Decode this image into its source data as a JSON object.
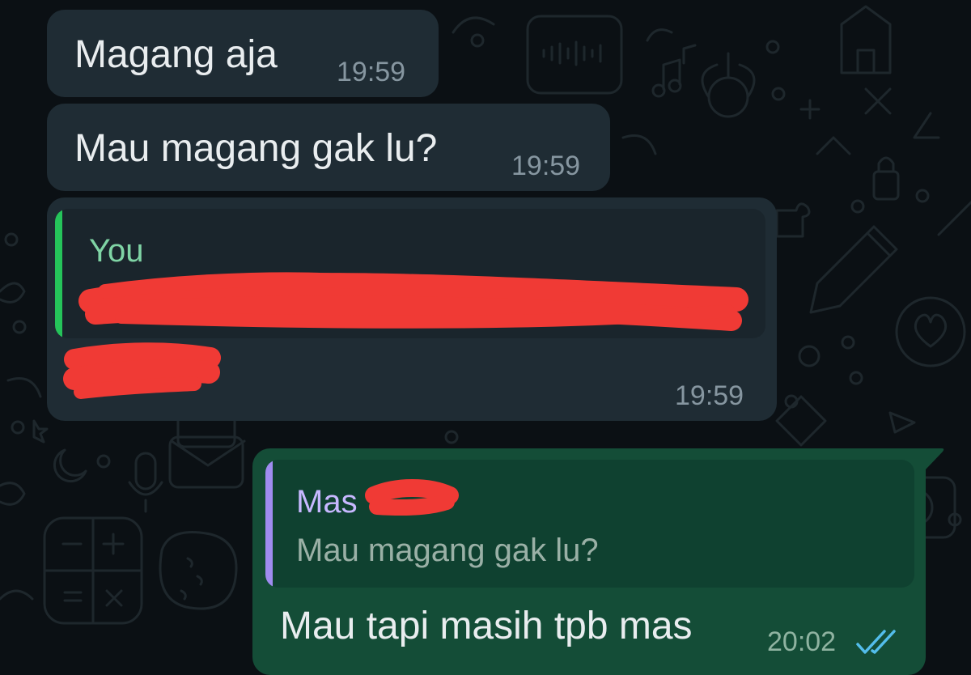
{
  "colors": {
    "background": "#0b1014",
    "incoming_bubble": "#1f2c34",
    "outgoing_bubble": "#144d37",
    "quote_self_author": "#7fd4a5",
    "quote_self_bar": "#25c45a",
    "quote_other_author": "#c7b8ff",
    "quote_other_bar": "#9f8cf0",
    "read_ticks": "#53bdeb",
    "redaction": "#f03a35"
  },
  "messages": [
    {
      "text": "Magang aja",
      "time": "19:59"
    },
    {
      "text": "Mau magang gak lu?",
      "time": "19:59"
    },
    {
      "quote_author": "You",
      "quote_text_visible": "",
      "text": "",
      "time": "19:59",
      "note": ""
    },
    {
      "quote_author": "Mas",
      "quote_text": "Mau magang gak lu?",
      "text": "Mau tapi masih tpb mas",
      "time": "20:02",
      "status_icon": "double-check-read-icon"
    }
  ]
}
